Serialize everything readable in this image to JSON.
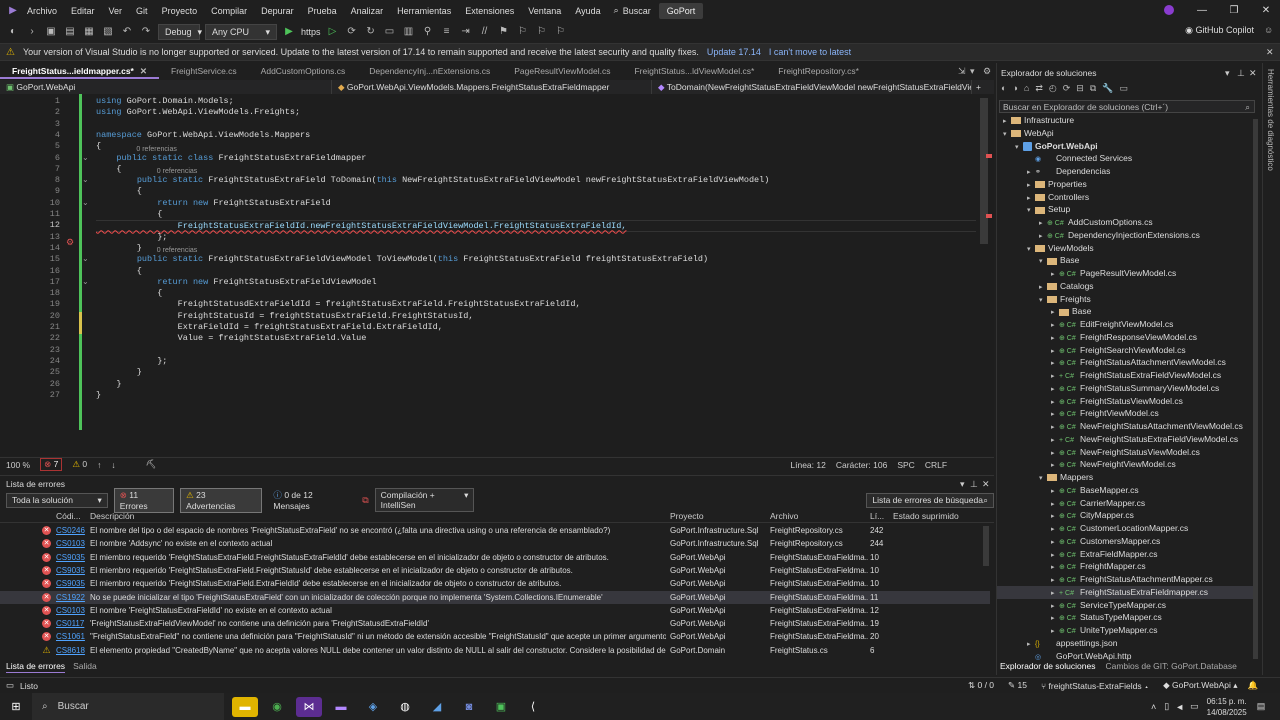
{
  "menu": [
    "Archivo",
    "Editar",
    "Ver",
    "Git",
    "Proyecto",
    "Compilar",
    "Depurar",
    "Prueba",
    "Analizar",
    "Herramientas",
    "Extensiones",
    "Ventana",
    "Ayuda"
  ],
  "search_label": "Buscar",
  "window_title": "GoPort",
  "toolbar": {
    "config": "Debug",
    "platform": "Any CPU",
    "run_target": "https",
    "copilot": "GitHub Copilot"
  },
  "infobar": {
    "message": "Your version of Visual Studio is no longer supported or serviced. Update to the latest version of 17.14 to remain supported and receive the latest security and quality fixes.",
    "update": "Update 17.14",
    "dismiss": "I can't move to latest"
  },
  "tabs": [
    "FreightStatus...ieldmapper.cs*",
    "FreightService.cs",
    "AddCustomOptions.cs",
    "DependencyInj...nExtensions.cs",
    "PageResultViewModel.cs",
    "FreightStatus...ldViewModel.cs*",
    "FreightRepository.cs*"
  ],
  "nav": {
    "project": "GoPort.WebApi",
    "class": "GoPort.WebApi.ViewModels.Mappers.FreightStatusExtraFieldmapper",
    "member": "ToDomain(NewFreightStatusExtraFieldViewModel newFreightStatusExtraFieldViewMo"
  },
  "code_lines": [
    {
      "n": "1",
      "t": "using GoPort.Domain.Models;",
      "cls": "",
      "lens": ""
    },
    {
      "n": "2",
      "t": "using GoPort.WebApi.ViewModels.Freights;",
      "cls": "",
      "lens": ""
    },
    {
      "n": "3",
      "t": "",
      "cls": "",
      "lens": ""
    },
    {
      "n": "4",
      "t": "namespace GoPort.WebApi.ViewModels.Mappers",
      "cls": "",
      "lens": ""
    },
    {
      "n": "5",
      "t": "{",
      "cls": "",
      "lens": ""
    },
    {
      "n": "6",
      "t": "    public static class FreightStatusExtraFieldmapper",
      "cls": "",
      "lens": "0 referencias"
    },
    {
      "n": "7",
      "t": "    {",
      "cls": "",
      "lens": ""
    },
    {
      "n": "8",
      "t": "        public static FreightStatusExtraField ToDomain(this NewFreightStatusExtraFieldViewModel newFreightStatusExtraFieldViewModel)",
      "cls": "",
      "lens": "0 referencias"
    },
    {
      "n": "9",
      "t": "        {",
      "cls": "",
      "lens": ""
    },
    {
      "n": "10",
      "t": "            return new FreightStatusExtraField",
      "cls": "",
      "lens": ""
    },
    {
      "n": "11",
      "t": "            {",
      "cls": "",
      "lens": ""
    },
    {
      "n": "12",
      "t": "                FreightStatusExtraFieldId.newFreightStatusExtraFieldViewModel.FreightStatusExtraFieldId,",
      "cls": "cur",
      "lens": ""
    },
    {
      "n": "13",
      "t": "            };",
      "cls": "",
      "lens": ""
    },
    {
      "n": "14",
      "t": "        }",
      "cls": "",
      "lens": ""
    },
    {
      "n": "15",
      "t": "        public static FreightStatusExtraFieldViewModel ToViewModel(this FreightStatusExtraField freightStatusExtraField)",
      "cls": "",
      "lens": "0 referencias"
    },
    {
      "n": "16",
      "t": "        {",
      "cls": "",
      "lens": ""
    },
    {
      "n": "17",
      "t": "            return new FreightStatusExtraFieldViewModel",
      "cls": "",
      "lens": ""
    },
    {
      "n": "18",
      "t": "            {",
      "cls": "",
      "lens": ""
    },
    {
      "n": "19",
      "t": "                FreightStatusdExtraFieldId = freightStatusExtraField.FreightStatusExtraFieldId,",
      "cls": "",
      "lens": ""
    },
    {
      "n": "20",
      "t": "                FreightStatusId = freightStatusExtraField.FreightStatusId,",
      "cls": "",
      "lens": ""
    },
    {
      "n": "21",
      "t": "                ExtraFieldId = freightStatusExtraField.ExtraFieldId,",
      "cls": "",
      "lens": ""
    },
    {
      "n": "22",
      "t": "                Value = freightStatusExtraField.Value",
      "cls": "",
      "lens": ""
    },
    {
      "n": "23",
      "t": "",
      "cls": "",
      "lens": ""
    },
    {
      "n": "24",
      "t": "            };",
      "cls": "",
      "lens": ""
    },
    {
      "n": "25",
      "t": "        }",
      "cls": "",
      "lens": ""
    },
    {
      "n": "26",
      "t": "    }",
      "cls": "",
      "lens": ""
    },
    {
      "n": "27",
      "t": "}",
      "cls": "",
      "lens": ""
    }
  ],
  "editor_status": {
    "zoom": "100 %",
    "errors": "7",
    "warnings": "0",
    "line": "Línea: 12",
    "col": "Carácter: 106",
    "spc": "SPC",
    "crlf": "CRLF"
  },
  "errors_panel": {
    "title": "Lista de errores",
    "scope": "Toda la solución",
    "errors": "11 Errores",
    "warnings": "23 Advertencias",
    "messages": "0 de 12 Mensajes",
    "build": "Compilación + IntelliSen",
    "search": "Lista de errores de búsqueda",
    "headers": {
      "code": "Códi...",
      "desc": "Descripción",
      "project": "Proyecto",
      "file": "Archivo",
      "line": "Lí...",
      "state": "Estado suprimido"
    },
    "rows": [
      {
        "type": "error",
        "code": "CS0246",
        "desc": "El nombre del tipo o del espacio de nombres 'FreightStatusExtraField' no se encontró (¿falta una directiva using o una referencia de ensamblado?)",
        "project": "GoPort.Infrastructure.Sql",
        "file": "FreightRepository.cs",
        "line": "242"
      },
      {
        "type": "error",
        "code": "CS0103",
        "desc": "El nombre 'Addsync' no existe en el contexto actual",
        "project": "GoPort.Infrastructure.Sql",
        "file": "FreightRepository.cs",
        "line": "244"
      },
      {
        "type": "error",
        "code": "CS9035",
        "desc": "El miembro requerido 'FreightStatusExtraField.FreightStatusExtraFieldId' debe establecerse en el inicializador de objeto o constructor de atributos.",
        "project": "GoPort.WebApi",
        "file": "FreightStatusExtraFieldma...",
        "line": "10"
      },
      {
        "type": "error",
        "code": "CS9035",
        "desc": "El miembro requerido 'FreightStatusExtraField.FreightStatusId' debe establecerse en el inicializador de objeto o constructor de atributos.",
        "project": "GoPort.WebApi",
        "file": "FreightStatusExtraFieldma...",
        "line": "10"
      },
      {
        "type": "error",
        "code": "CS9035",
        "desc": "El miembro requerido 'FreightStatusExtraField.ExtraFieldId' debe establecerse en el inicializador de objeto o constructor de atributos.",
        "project": "GoPort.WebApi",
        "file": "FreightStatusExtraFieldma...",
        "line": "10"
      },
      {
        "type": "error",
        "code": "CS1922",
        "desc": "No se puede inicializar el tipo 'FreightStatusExtraField' con un inicializador de colección porque no implementa 'System.Collections.IEnumerable'",
        "project": "GoPort.WebApi",
        "file": "FreightStatusExtraFieldma...",
        "line": "11"
      },
      {
        "type": "error",
        "code": "CS0103",
        "desc": "El nombre 'FreightStatusExtraFieldId' no existe en el contexto actual",
        "project": "GoPort.WebApi",
        "file": "FreightStatusExtraFieldma...",
        "line": "12"
      },
      {
        "type": "error",
        "code": "CS0117",
        "desc": "'FreightStatusExtraFieldViewModel' no contiene una definición para 'FreightStatusdExtraFieldId'",
        "project": "GoPort.WebApi",
        "file": "FreightStatusExtraFieldma...",
        "line": "19"
      },
      {
        "type": "error",
        "code": "CS1061",
        "desc": "\"FreightStatusExtraField\" no contiene una definición para \"FreightStatusId\" ni un método de extensión accesible \"FreightStatusId\" que acepte un primer argumento del tipo \"FreightStatusExtraField\" (¿falta alguna directiva using o una referencia de ensamblado?)",
        "project": "GoPort.WebApi",
        "file": "FreightStatusExtraFieldma...",
        "line": "20"
      },
      {
        "type": "warn",
        "code": "CS8618",
        "desc": "El elemento propiedad \"CreatedByName\" que no acepta valores NULL debe contener un valor distinto de NULL al salir del constructor. Considere la posibilidad de",
        "project": "GoPort.Domain",
        "file": "FreightStatus.cs",
        "line": "6"
      }
    ]
  },
  "bottom_tabs": [
    "Lista de errores",
    "Salida"
  ],
  "solution_explorer": {
    "title": "Explorador de soluciones",
    "search": "Buscar en Explorador de soluciones (Ctrl+´)",
    "items": [
      {
        "label": "Infrastructure",
        "depth": 0,
        "kind": "folder",
        "exp": "▸"
      },
      {
        "label": "WebApi",
        "depth": 0,
        "kind": "folder",
        "exp": "▾"
      },
      {
        "label": "GoPort.WebApi",
        "depth": 1,
        "kind": "proj",
        "exp": "▾",
        "bold": true
      },
      {
        "label": "Connected Services",
        "depth": 2,
        "kind": "svc",
        "exp": ""
      },
      {
        "label": "Dependencias",
        "depth": 2,
        "kind": "dep",
        "exp": "▸"
      },
      {
        "label": "Properties",
        "depth": 2,
        "kind": "folder",
        "exp": "▸"
      },
      {
        "label": "Controllers",
        "depth": 2,
        "kind": "folder",
        "exp": "▸"
      },
      {
        "label": "Setup",
        "depth": 2,
        "kind": "folder",
        "exp": "▾"
      },
      {
        "label": "AddCustomOptions.cs",
        "depth": 3,
        "kind": "cs",
        "exp": "▸"
      },
      {
        "label": "DependencyInjectionExtensions.cs",
        "depth": 3,
        "kind": "cs",
        "exp": "▸"
      },
      {
        "label": "ViewModels",
        "depth": 2,
        "kind": "folder",
        "exp": "▾"
      },
      {
        "label": "Base",
        "depth": 3,
        "kind": "folder",
        "exp": "▾"
      },
      {
        "label": "PageResultViewModel.cs",
        "depth": 4,
        "kind": "cs",
        "exp": "▸"
      },
      {
        "label": "Catalogs",
        "depth": 3,
        "kind": "folder",
        "exp": "▸"
      },
      {
        "label": "Freights",
        "depth": 3,
        "kind": "folder",
        "exp": "▾"
      },
      {
        "label": "Base",
        "depth": 4,
        "kind": "folder",
        "exp": "▸"
      },
      {
        "label": "EditFreightViewModel.cs",
        "depth": 4,
        "kind": "cs",
        "exp": "▸"
      },
      {
        "label": "FreightResponseViewModel.cs",
        "depth": 4,
        "kind": "cs",
        "exp": "▸"
      },
      {
        "label": "FreightSearchViewModel.cs",
        "depth": 4,
        "kind": "cs",
        "exp": "▸"
      },
      {
        "label": "FreightStatusAttachmentViewModel.cs",
        "depth": 4,
        "kind": "cs",
        "exp": "▸"
      },
      {
        "label": "FreightStatusExtraFieldViewModel.cs",
        "depth": 4,
        "kind": "csp",
        "exp": "▸"
      },
      {
        "label": "FreightStatusSummaryViewModel.cs",
        "depth": 4,
        "kind": "cs",
        "exp": "▸"
      },
      {
        "label": "FreightStatusViewModel.cs",
        "depth": 4,
        "kind": "cs",
        "exp": "▸"
      },
      {
        "label": "FreightViewModel.cs",
        "depth": 4,
        "kind": "cs",
        "exp": "▸"
      },
      {
        "label": "NewFreightStatusAttachmentViewModel.cs",
        "depth": 4,
        "kind": "cs",
        "exp": "▸"
      },
      {
        "label": "NewFreightStatusExtraFieldViewModel.cs",
        "depth": 4,
        "kind": "csp",
        "exp": "▸"
      },
      {
        "label": "NewFreightStatusViewModel.cs",
        "depth": 4,
        "kind": "cs",
        "exp": "▸"
      },
      {
        "label": "NewFreightViewModel.cs",
        "depth": 4,
        "kind": "cs",
        "exp": "▸"
      },
      {
        "label": "Mappers",
        "depth": 3,
        "kind": "folder",
        "exp": "▾"
      },
      {
        "label": "BaseMapper.cs",
        "depth": 4,
        "kind": "cs",
        "exp": "▸"
      },
      {
        "label": "CarrierMapper.cs",
        "depth": 4,
        "kind": "cs",
        "exp": "▸"
      },
      {
        "label": "CityMapper.cs",
        "depth": 4,
        "kind": "cs",
        "exp": "▸"
      },
      {
        "label": "CustomerLocationMapper.cs",
        "depth": 4,
        "kind": "cs",
        "exp": "▸"
      },
      {
        "label": "CustomersMapper.cs",
        "depth": 4,
        "kind": "cs",
        "exp": "▸"
      },
      {
        "label": "ExtraFieldMapper.cs",
        "depth": 4,
        "kind": "cs",
        "exp": "▸"
      },
      {
        "label": "FreightMapper.cs",
        "depth": 4,
        "kind": "cs",
        "exp": "▸"
      },
      {
        "label": "FreightStatusAttachmentMapper.cs",
        "depth": 4,
        "kind": "cs",
        "exp": "▸"
      },
      {
        "label": "FreightStatusExtraFieldmapper.cs",
        "depth": 4,
        "kind": "csp",
        "exp": "▸",
        "sel": true
      },
      {
        "label": "ServiceTypeMapper.cs",
        "depth": 4,
        "kind": "cs",
        "exp": "▸"
      },
      {
        "label": "StatusTypeMapper.cs",
        "depth": 4,
        "kind": "cs",
        "exp": "▸"
      },
      {
        "label": "UniteTypeMapper.cs",
        "depth": 4,
        "kind": "cs",
        "exp": "▸"
      },
      {
        "label": "appsettings.json",
        "depth": 2,
        "kind": "json",
        "exp": "▸"
      },
      {
        "label": "GoPort.WebApi.http",
        "depth": 2,
        "kind": "http",
        "exp": ""
      }
    ],
    "tabs": [
      "Explorador de soluciones",
      "Cambios de GIT: GoPort.Database"
    ]
  },
  "diag_label": "Herramientas de diagnóstico",
  "status": {
    "ready": "Listo",
    "changes": "0 / 0",
    "commits": "15",
    "branch": "freightStatus-ExtraFields",
    "repo": "GoPort.WebApi"
  },
  "taskbar": {
    "search": "Buscar",
    "time": "06:15 p. m.",
    "date": "14/08/2025"
  }
}
